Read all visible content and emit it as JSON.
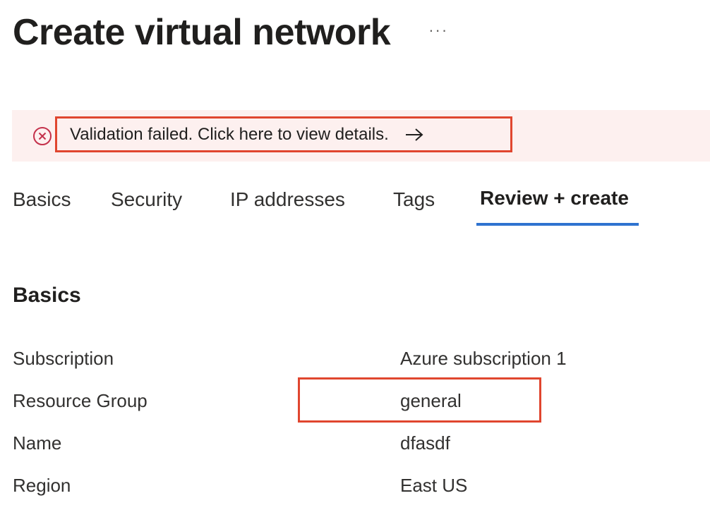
{
  "header": {
    "title": "Create virtual network",
    "more_label": "···"
  },
  "alert": {
    "message": "Validation failed. Click here to view details.",
    "icon": "error-circle-icon",
    "arrow_icon": "arrow-right-icon",
    "accent_color": "#c4314b"
  },
  "tabs": [
    {
      "label": "Basics"
    },
    {
      "label": "Security"
    },
    {
      "label": "IP addresses"
    },
    {
      "label": "Tags"
    },
    {
      "label": "Review + create",
      "active": true
    }
  ],
  "section": {
    "title": "Basics",
    "rows": [
      {
        "label": "Subscription",
        "value": "Azure subscription 1"
      },
      {
        "label": "Resource Group",
        "value": "general"
      },
      {
        "label": "Name",
        "value": "dfasdf"
      },
      {
        "label": "Region",
        "value": "East US"
      }
    ]
  },
  "colors": {
    "alert_background": "#fdf0ef",
    "annotation_border": "#e0462f",
    "active_tab_underline": "#2f73d0"
  }
}
